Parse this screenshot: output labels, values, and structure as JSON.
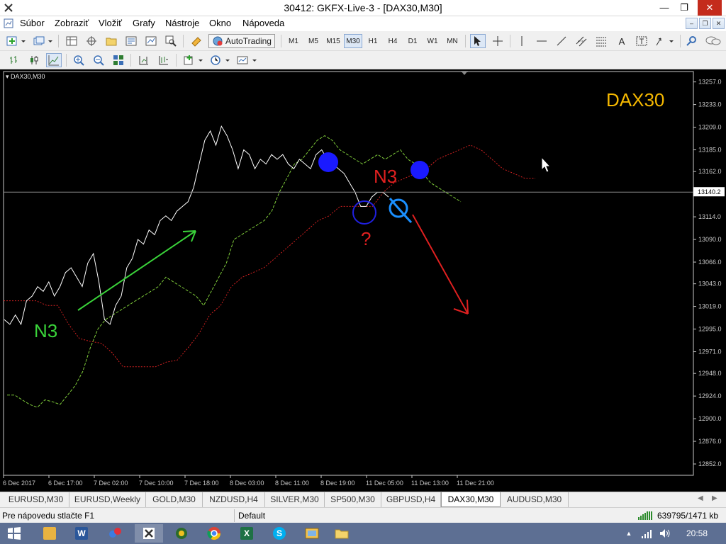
{
  "window": {
    "title": "30412: GKFX-Live-3 - [DAX30,M30]",
    "minimize": "—",
    "maximize": "❐",
    "close": "✕"
  },
  "menu": {
    "items": [
      "Súbor",
      "Zobraziť",
      "Vložiť",
      "Grafy",
      "Nástroje",
      "Okno",
      "Nápoveda"
    ],
    "child_controls": [
      "–",
      "❐",
      "✕"
    ]
  },
  "toolbar": {
    "autotrading_label": "AutoTrading",
    "timeframes": [
      "M1",
      "M5",
      "M15",
      "M30",
      "H1",
      "H4",
      "D1",
      "W1",
      "MN"
    ],
    "active_timeframe": "M30",
    "text_tool": "A",
    "label_tool": "T"
  },
  "chart": {
    "symbol_label": "DAX30,M30",
    "watermark": "DAX30",
    "current_price_label": "13140.2",
    "annotations": {
      "n3_left": "N3",
      "n3_right": "N3",
      "question": "?"
    },
    "colors": {
      "background": "#000000",
      "price_line": "#ffffff",
      "chikou_span": "#7fcc3a",
      "senkou_b": "#d02020",
      "watermark": "#f5b800",
      "arrow_up": "#3ad43a",
      "arrow_down": "#e02020",
      "marker_fill": "#1a1aff"
    }
  },
  "chart_data": {
    "type": "line",
    "title": "",
    "xlabel": "",
    "ylabel": "",
    "ylim": [
      12840,
      13268
    ],
    "y_ticks": [
      "13257.0",
      "13233.0",
      "13209.0",
      "13185.0",
      "13162.0",
      "13138.0",
      "13114.0",
      "13090.0",
      "13066.0",
      "13043.0",
      "13019.0",
      "12995.0",
      "12971.0",
      "12948.0",
      "12924.0",
      "12900.0",
      "12876.0",
      "12852.0"
    ],
    "x_ticks": [
      "6 Dec 2017",
      "6 Dec 17:00",
      "7 Dec 02:00",
      "7 Dec 10:00",
      "7 Dec 18:00",
      "8 Dec 03:00",
      "8 Dec 11:00",
      "8 Dec 19:00",
      "11 Dec 05:00",
      "11 Dec 13:00",
      "11 Dec 21:00"
    ],
    "current_price": 13140.2,
    "series": [
      {
        "values": [
          13005,
          13000,
          13010,
          13000,
          13025,
          13030,
          13040,
          13035,
          13045,
          13030,
          13040,
          13055,
          13060,
          13050,
          13040,
          13065,
          13075,
          13045,
          13005,
          13000,
          13020,
          13030,
          13060,
          13070,
          13090,
          13085,
          13100,
          13095,
          13110,
          13115,
          13110,
          13120,
          13125,
          13130,
          13145,
          13170,
          13195,
          13205,
          13190,
          13210,
          13200,
          13185,
          13165,
          13185,
          13180,
          13165,
          13175,
          13170,
          13180,
          13175,
          13180,
          13170,
          13165,
          13175,
          13170,
          13165,
          13180,
          13185,
          13175,
          13170,
          13165,
          13160,
          13150,
          13140,
          13125,
          13125,
          13135,
          13140,
          13140,
          13135
        ]
      },
      {
        "values": [
          12925,
          12925,
          12920,
          12915,
          12912,
          12920,
          12918,
          12915,
          12925,
          12935,
          12950,
          12975,
          12995,
          13005,
          13010,
          13015,
          13020,
          13025,
          13030,
          13035,
          13040,
          13050,
          13045,
          13040,
          13035,
          13030,
          13020,
          13035,
          13050,
          13065,
          13090,
          13095,
          13100,
          13105,
          13110,
          13120,
          13140,
          13155,
          13170,
          13175,
          13185,
          13195,
          13200,
          13195,
          13185,
          13180,
          13175,
          13170,
          13175,
          13180,
          13175,
          13180,
          13185,
          13175,
          13170,
          13160,
          13150,
          13145,
          13140,
          13135,
          13130
        ]
      },
      {
        "values": [
          13025,
          13025,
          13025,
          13025,
          13020,
          13020,
          13000,
          12985,
          12982,
          12980,
          12970,
          12955,
          12955,
          12955,
          12955,
          12960,
          12962,
          12975,
          12990,
          13010,
          13020,
          13040,
          13050,
          13055,
          13060,
          13070,
          13080,
          13090,
          13100,
          13110,
          13115,
          13125,
          13125,
          13125,
          13125,
          13140,
          13150,
          13155,
          13160,
          13165,
          13175,
          13180,
          13185,
          13190,
          13185,
          13175,
          13165,
          13160,
          13155,
          13155
        ]
      }
    ]
  },
  "tabs": {
    "items": [
      "EURUSD,M30",
      "EURUSD,Weekly",
      "GOLD,M30",
      "NZDUSD,H4",
      "SILVER,M30",
      "SP500,M30",
      "GBPUSD,H4",
      "DAX30,M30",
      "AUDUSD,M30"
    ],
    "active": "DAX30,M30",
    "scroll_left": "◀",
    "scroll_right": "▶"
  },
  "status": {
    "help_text": "Pre nápovedu stlačte F1",
    "profile": "Default",
    "traffic": "639795/1471 kb"
  },
  "taskbar": {
    "apps": [
      "windows-start",
      "file-explorer",
      "word",
      "app-red-blue",
      "metatrader",
      "web-app",
      "chrome",
      "excel",
      "skype",
      "screenshot-tool",
      "folder"
    ],
    "clock": "20:58",
    "tray_up": "▲"
  }
}
